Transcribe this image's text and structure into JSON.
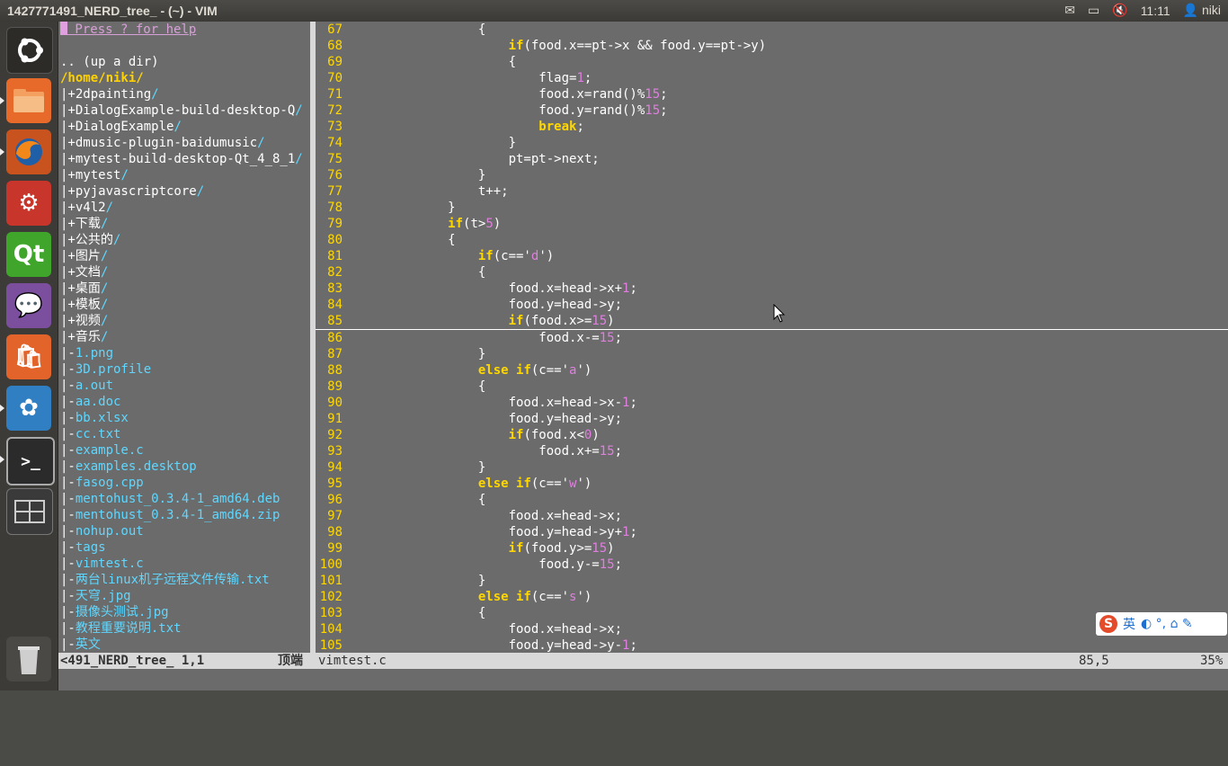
{
  "window": {
    "title": "1427771491_NERD_tree_ - (~) - VIM",
    "clock": "11:11",
    "user": "niki"
  },
  "launcher": [
    {
      "name": "dash-home-icon",
      "glyph": ""
    },
    {
      "name": "files-icon",
      "glyph": ""
    },
    {
      "name": "firefox-icon",
      "glyph": ""
    },
    {
      "name": "system-settings-icon",
      "glyph": ""
    },
    {
      "name": "qt-creator-icon",
      "glyph": "Qt"
    },
    {
      "name": "pidgin-icon",
      "glyph": ""
    },
    {
      "name": "software-center-icon",
      "glyph": ""
    },
    {
      "name": "shotwell-icon",
      "glyph": ""
    },
    {
      "name": "terminal-icon",
      "glyph": ">_"
    },
    {
      "name": "workspace-switcher-icon",
      "glyph": ""
    },
    {
      "name": "trash-icon",
      "glyph": ""
    }
  ],
  "tree": {
    "help": " Press ? for help",
    "up_dir": ".. (up a dir)",
    "cwd": "/home/niki/",
    "dirs": [
      "2dpainting",
      "DialogExample-build-desktop-Q",
      "DialogExample",
      "dmusic-plugin-baidumusic",
      "mytest-build-desktop-Qt_4_8_1",
      "mytest",
      "pyjavascriptcore",
      "v4l2",
      "下载",
      "公共的",
      "图片",
      "文档",
      "桌面",
      "模板",
      "视频",
      "音乐"
    ],
    "files": [
      "1.png",
      "3D.profile",
      "a.out",
      "aa.doc",
      "bb.xlsx",
      "cc.txt",
      "example.c",
      "examples.desktop",
      "fasog.cpp",
      "mentohust_0.3.4-1_amd64.deb",
      "mentohust_0.3.4-1_amd64.zip",
      "nohup.out",
      "tags",
      "vimtest.c",
      "两台linux机子远程文件传输.txt",
      "天穹.jpg",
      "摄像头测试.jpg",
      "教程重要说明.txt",
      "英文"
    ]
  },
  "code": [
    {
      "n": "67",
      "t": "                {"
    },
    {
      "n": "68",
      "t": "                    if(food.x==pt->x && food.y==pt->y)"
    },
    {
      "n": "69",
      "t": "                    {"
    },
    {
      "n": "70",
      "t": "                        flag=1;"
    },
    {
      "n": "71",
      "t": "                        food.x=rand()%15;"
    },
    {
      "n": "72",
      "t": "                        food.y=rand()%15;"
    },
    {
      "n": "73",
      "t": "                        break;"
    },
    {
      "n": "74",
      "t": "                    }"
    },
    {
      "n": "75",
      "t": "                    pt=pt->next;"
    },
    {
      "n": "76",
      "t": "                }"
    },
    {
      "n": "77",
      "t": "                t++;"
    },
    {
      "n": "78",
      "t": "            }"
    },
    {
      "n": "79",
      "t": "            if(t>5)"
    },
    {
      "n": "80",
      "t": "            {"
    },
    {
      "n": "81",
      "t": "                if(c=='d')"
    },
    {
      "n": "82",
      "t": "                {"
    },
    {
      "n": "83",
      "t": "                    food.x=head->x+1;"
    },
    {
      "n": "84",
      "t": "                    food.y=head->y;"
    },
    {
      "n": "85",
      "t": "                    if(food.x>=15)"
    },
    {
      "n": "86",
      "t": "                        food.x-=15;"
    },
    {
      "n": "87",
      "t": "                }"
    },
    {
      "n": "88",
      "t": "                else if(c=='a')"
    },
    {
      "n": "89",
      "t": "                {"
    },
    {
      "n": "90",
      "t": "                    food.x=head->x-1;"
    },
    {
      "n": "91",
      "t": "                    food.y=head->y;"
    },
    {
      "n": "92",
      "t": "                    if(food.x<0)"
    },
    {
      "n": "93",
      "t": "                        food.x+=15;"
    },
    {
      "n": "94",
      "t": "                }"
    },
    {
      "n": "95",
      "t": "                else if(c=='w')"
    },
    {
      "n": "96",
      "t": "                {"
    },
    {
      "n": "97",
      "t": "                    food.x=head->x;"
    },
    {
      "n": "98",
      "t": "                    food.y=head->y+1;"
    },
    {
      "n": "99",
      "t": "                    if(food.y>=15)"
    },
    {
      "n": "100",
      "t": "                        food.y-=15;"
    },
    {
      "n": "101",
      "t": "                }"
    },
    {
      "n": "102",
      "t": "                else if(c=='s')"
    },
    {
      "n": "103",
      "t": "                {"
    },
    {
      "n": "104",
      "t": "                    food.x=head->x;"
    },
    {
      "n": "105",
      "t": "                    food.y=head->y-1;"
    }
  ],
  "status": {
    "tree_buffer": "<491_NERD_tree_ 1,1",
    "tree_pos": "顶端",
    "file": "vimtest.c",
    "cursor": "85,5",
    "percent": "35%"
  },
  "ime": {
    "lang": "英",
    "extras": "◐ °, ⌂ ✎"
  },
  "colors": {
    "editor_bg": "#6b6b6b",
    "line_number": "#ffd700",
    "keyword": "#ffd700",
    "number": "#e07fe0",
    "tree_file": "#5fd7ff"
  }
}
